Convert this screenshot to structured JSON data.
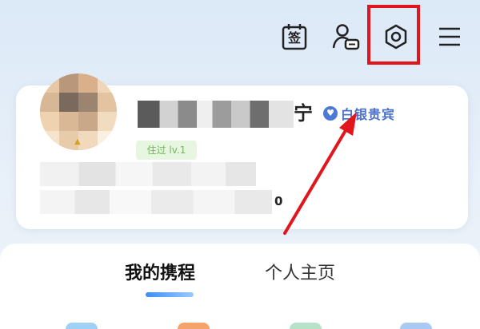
{
  "header": {
    "icons": [
      "calendar-sign-in-icon",
      "contact-service-icon",
      "settings-gear-icon",
      "menu-icon"
    ],
    "calendar_glyph": "签",
    "highlight_color": "#e0161c"
  },
  "profile": {
    "name_visible_tail": "宁",
    "vip_icon_glyph": "♥",
    "vip_label": "白银贵宾",
    "level_label": "住过 lv.1",
    "stat_value": "0"
  },
  "tabs": [
    {
      "label": "我的携程",
      "active": true
    },
    {
      "label": "个人主页",
      "active": false
    }
  ],
  "colors": {
    "accent_blue": "#3b8ef6",
    "vip_blue": "#4a72c9",
    "annotation_red": "#e0161c"
  }
}
